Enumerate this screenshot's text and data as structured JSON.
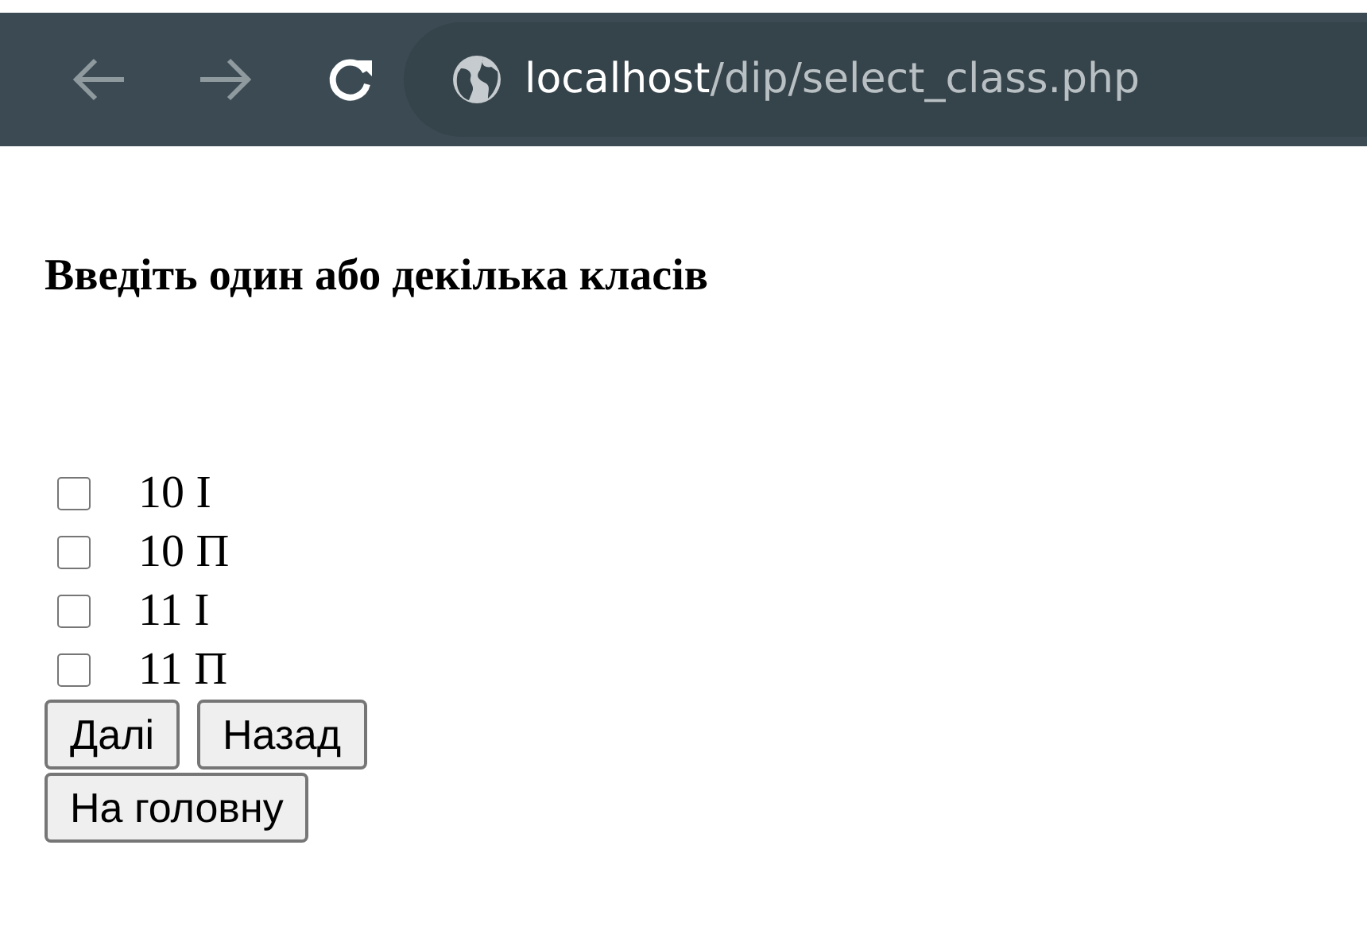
{
  "browser": {
    "url_host": "localhost",
    "url_path": "/dip/select_class.php"
  },
  "heading": "Введіть один або декілька класів",
  "classes": [
    {
      "label": "10 І",
      "checked": false
    },
    {
      "label": "10 П",
      "checked": false
    },
    {
      "label": "11 І",
      "checked": false
    },
    {
      "label": "11 П",
      "checked": false
    }
  ],
  "buttons": [
    "Далі",
    "Назад",
    "На головну"
  ]
}
